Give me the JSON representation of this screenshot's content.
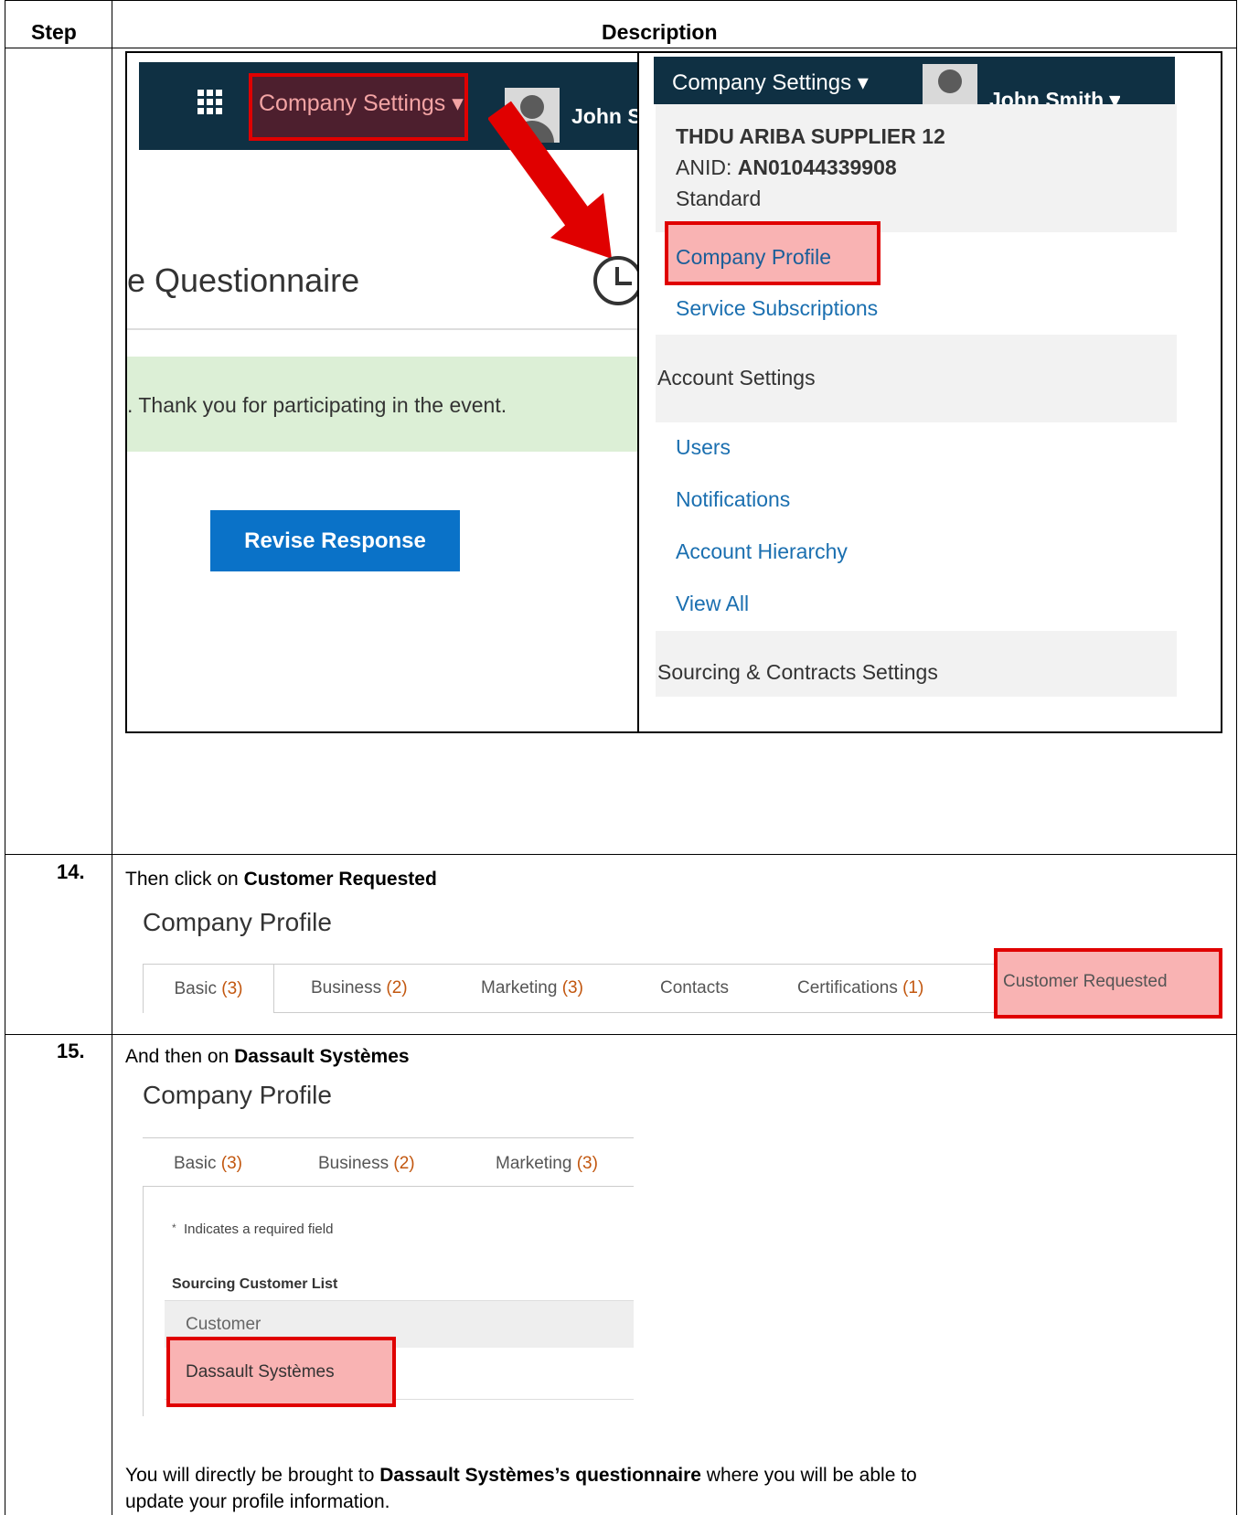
{
  "header": {
    "step": "Step",
    "description": "Description"
  },
  "shot1": {
    "company_settings": "Company Settings ▾",
    "user_short": "John Sm",
    "questionnaire_title": "e Questionnaire",
    "thanks": ". Thank you for participating in the event.",
    "revise_button": "Revise Response",
    "dropdown": {
      "company_settings": "Company Settings ▾",
      "user": "John Smith ▾",
      "supplier_name": "THDU ARIBA SUPPLIER 12",
      "anid_label": "ANID: ",
      "anid_value": "AN01044339908",
      "account_type": "Standard",
      "company_profile": "Company Profile",
      "service_subscriptions": "Service Subscriptions",
      "account_settings": "Account Settings",
      "users": "Users",
      "notifications": "Notifications",
      "account_hierarchy": "Account Hierarchy",
      "view_all": "View All",
      "sourcing_settings": "Sourcing & Contracts Settings"
    }
  },
  "step14": {
    "number": "14.",
    "text_prefix": "Then click on ",
    "text_bold": "Customer Requested",
    "profile_title": "Company Profile",
    "tabs": [
      {
        "label": "Basic",
        "count": "(3)"
      },
      {
        "label": "Business",
        "count": "(2)"
      },
      {
        "label": "Marketing",
        "count": "(3)"
      },
      {
        "label": "Contacts",
        "count": ""
      },
      {
        "label": "Certifications",
        "count": "(1)"
      },
      {
        "label": "Customer Requested",
        "count": ""
      }
    ]
  },
  "step15": {
    "number": "15.",
    "text_prefix": "And then on ",
    "text_bold": "Dassault Systèmes",
    "profile_title": "Company Profile",
    "tabs": [
      {
        "label": "Basic",
        "count": "(3)"
      },
      {
        "label": "Business",
        "count": "(2)"
      },
      {
        "label": "Marketing",
        "count": "(3)"
      }
    ],
    "required_note": "Indicates a required field",
    "required_star": "*",
    "list_title": "Sourcing Customer List",
    "column_header": "Customer",
    "row": "Dassault Systèmes",
    "footer_prefix": "You will directly be brought to ",
    "footer_bold": "Dassault Systèmes’s questionnaire",
    "footer_suffix": " where you will be able to",
    "footer_line2": "update your profile information."
  },
  "colors": {
    "ariba_dark": "#0f3043",
    "ariba_blue": "#0a72c8",
    "highlight_red": "#e00000",
    "highlight_fill": "#f9b3b3"
  }
}
